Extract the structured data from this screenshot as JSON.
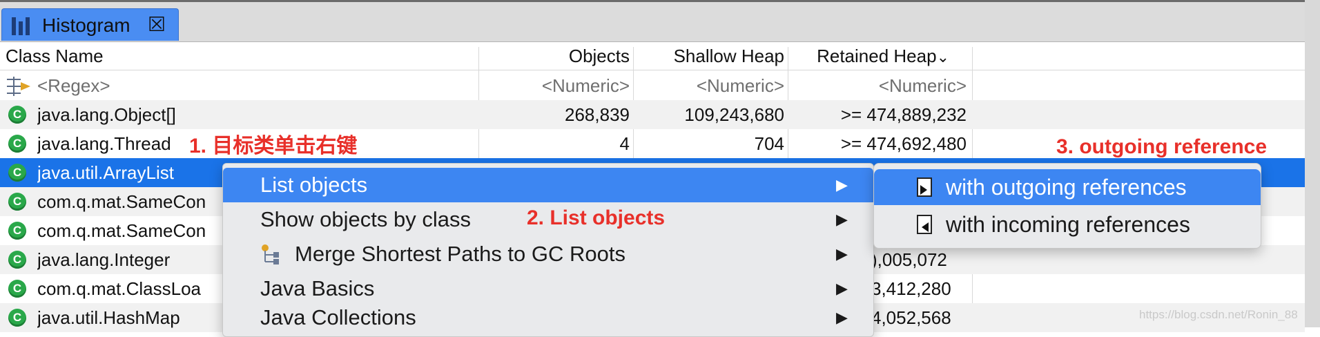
{
  "tab": {
    "title": "Histogram",
    "close_glyph": "⮽"
  },
  "columns": {
    "class_name": "Class Name",
    "objects": "Objects",
    "shallow_heap": "Shallow Heap",
    "retained_heap": "Retained Heap",
    "sort_indicator": "⌄"
  },
  "filter_row": {
    "regex": "<Regex>",
    "objects": "<Numeric>",
    "shallow": "<Numeric>",
    "retained": "<Numeric>"
  },
  "rows": [
    {
      "name": "java.lang.Object[]",
      "objects": "268,839",
      "shallow": "109,243,680",
      "retained": ">= 474,889,232"
    },
    {
      "name": "java.lang.Thread",
      "objects": "4",
      "shallow": "704",
      "retained": ">= 474,692,480"
    },
    {
      "name": "java.util.ArrayList",
      "objects": "",
      "shallow": "",
      "retained": ""
    },
    {
      "name": "com.q.mat.SameCon",
      "objects": "",
      "shallow": "",
      "retained": ""
    },
    {
      "name": "com.q.mat.SameCon",
      "objects": "",
      "shallow": "",
      "retained": ""
    },
    {
      "name": "java.lang.Integer",
      "objects": "",
      "shallow": "",
      "retained": "),005,072"
    },
    {
      "name": "com.q.mat.ClassLoa",
      "objects": "",
      "shallow": "",
      "retained": "3,412,280"
    },
    {
      "name": "java.util.HashMap",
      "objects": "",
      "shallow": "",
      "retained": "4,052,568"
    }
  ],
  "class_icon_letter": "C",
  "annotations": {
    "step1": "1. 目标类单击右键",
    "step2": "2. List objects",
    "step3": "3. outgoing reference"
  },
  "context_menu": {
    "items": [
      {
        "label": "List objects",
        "arrow": "▶"
      },
      {
        "label": "Show objects by class",
        "arrow": "▶"
      },
      {
        "label": "Merge Shortest Paths to GC Roots",
        "arrow": "▶"
      },
      {
        "label": "Java Basics",
        "arrow": "▶"
      },
      {
        "label": "Java Collections",
        "arrow": "▶"
      }
    ]
  },
  "submenu": {
    "items": [
      {
        "label": "with outgoing references"
      },
      {
        "label": "with incoming references"
      }
    ]
  },
  "watermark": "https://blog.csdn.net/Ronin_88",
  "colors": {
    "selection": "#1a73e8",
    "tab_active": "#4a8df2",
    "menu_highlight": "#3d86f2",
    "annotation": "#e8302a",
    "class_icon": "#2aa84a"
  }
}
